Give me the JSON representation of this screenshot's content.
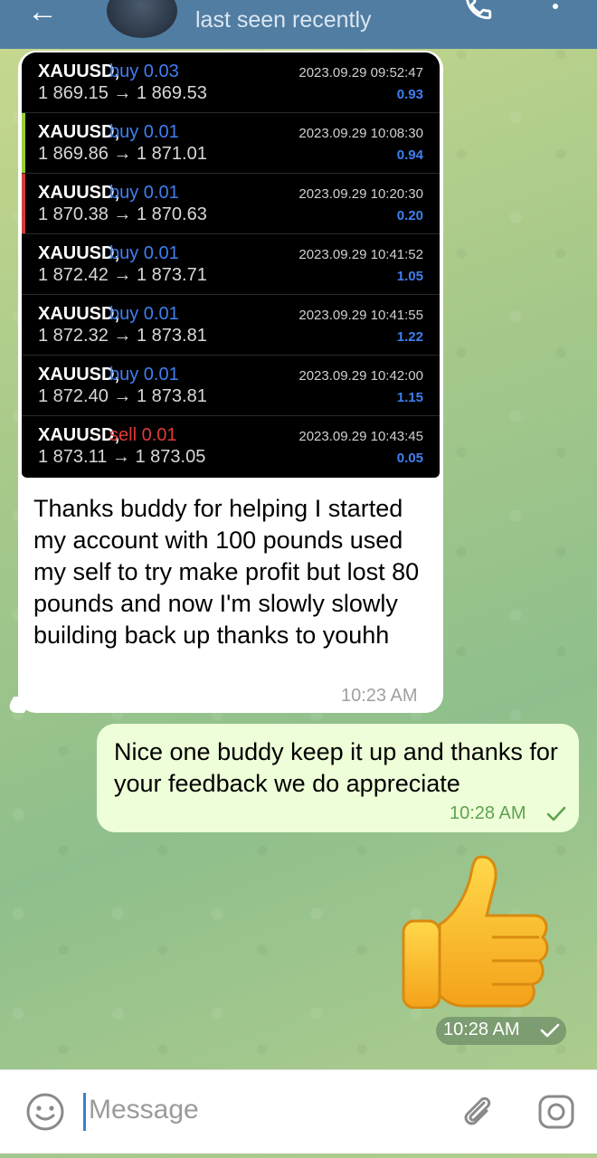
{
  "header": {
    "status": "last seen recently"
  },
  "trades": [
    {
      "symbol": "XAUUSD,",
      "side": "buy 0.03",
      "side_color": "#3f7ff0",
      "prices": "1 869.15 → 1 869.53",
      "time": "2023.09.29 09:52:47",
      "profit": "0.93",
      "bar_color": "#000000"
    },
    {
      "symbol": "XAUUSD,",
      "side": "buy 0.01",
      "side_color": "#3f7ff0",
      "prices": "1 869.86 → 1 871.01",
      "time": "2023.09.29 10:08:30",
      "profit": "0.94",
      "bar_color": "#9acd32"
    },
    {
      "symbol": "XAUUSD,",
      "side": "buy 0.01",
      "side_color": "#3f7ff0",
      "prices": "1 870.38 → 1 870.63",
      "time": "2023.09.29 10:20:30",
      "profit": "0.20",
      "bar_color": "#d23a3a"
    },
    {
      "symbol": "XAUUSD,",
      "side": "buy 0.01",
      "side_color": "#3f7ff0",
      "prices": "1 872.42 → 1 873.71",
      "time": "2023.09.29 10:41:52",
      "profit": "1.05",
      "bar_color": "#000000"
    },
    {
      "symbol": "XAUUSD,",
      "side": "buy 0.01",
      "side_color": "#3f7ff0",
      "prices": "1 872.32 → 1 873.81",
      "time": "2023.09.29 10:41:55",
      "profit": "1.22",
      "bar_color": "#000000"
    },
    {
      "symbol": "XAUUSD,",
      "side": "buy 0.01",
      "side_color": "#3f7ff0",
      "prices": "1 872.40 → 1 873.81",
      "time": "2023.09.29 10:42:00",
      "profit": "1.15",
      "bar_color": "#000000"
    },
    {
      "symbol": "XAUUSD,",
      "side": "sell 0.01",
      "side_color": "#e03a3a",
      "prices": "1 873.11 → 1 873.05",
      "time": "2023.09.29 10:43:45",
      "profit": "0.05",
      "bar_color": "#000000"
    }
  ],
  "incoming": {
    "text": "Thanks buddy for helping I started my account with 100 pounds used my self to try make profit but lost 80 pounds and now I'm slowly slowly building back up thanks to youhh",
    "time": "10:23 AM"
  },
  "outgoing": {
    "text": "Nice one buddy keep it up and thanks for your feedback we do appreciate",
    "time": "10:28 AM"
  },
  "emoji_message": {
    "emoji": "thumbs-up",
    "time": "10:28 AM"
  },
  "input": {
    "placeholder": "Message"
  },
  "icons": {
    "back": "arrow-left-icon",
    "phone": "phone-icon",
    "more": "more-vertical-icon",
    "emoji": "smile-icon",
    "attach": "paperclip-icon",
    "camera": "camera-icon",
    "read": "check-icon"
  },
  "colors": {
    "header": "#517da2",
    "outgoing_bubble": "#eefed8",
    "profit": "#3f7ff0",
    "sell": "#e03a3a"
  }
}
